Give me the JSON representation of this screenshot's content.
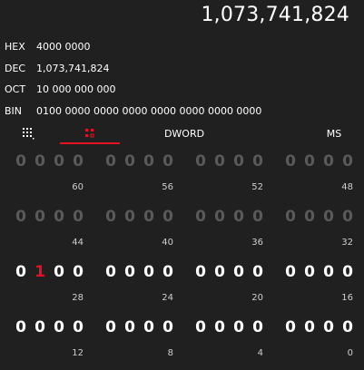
{
  "display": {
    "value": "1,073,741,824"
  },
  "radix": [
    {
      "label": "HEX",
      "value": "4000 0000"
    },
    {
      "label": "DEC",
      "value": "1,073,741,824"
    },
    {
      "label": "OCT",
      "value": "10 000 000 000"
    },
    {
      "label": "BIN",
      "value": "0100 0000 0000 0000 0000 0000 0000 0000"
    }
  ],
  "toolbar": {
    "keypad_icon": "full-keypad-icon",
    "bitflip_icon": "bit-toggling-keypad-icon",
    "word_size": "DWORD",
    "memory": "MS"
  },
  "colors": {
    "accent": "#e81123",
    "background": "#202020",
    "disabled": "#5a5a5a"
  },
  "bit_rows": [
    {
      "nibbles": [
        {
          "bits": [
            "0",
            "0",
            "0",
            "0"
          ],
          "position": "60",
          "enabled": false
        },
        {
          "bits": [
            "0",
            "0",
            "0",
            "0"
          ],
          "position": "56",
          "enabled": false
        },
        {
          "bits": [
            "0",
            "0",
            "0",
            "0"
          ],
          "position": "52",
          "enabled": false
        },
        {
          "bits": [
            "0",
            "0",
            "0",
            "0"
          ],
          "position": "48",
          "enabled": false
        }
      ]
    },
    {
      "nibbles": [
        {
          "bits": [
            "0",
            "0",
            "0",
            "0"
          ],
          "position": "44",
          "enabled": false
        },
        {
          "bits": [
            "0",
            "0",
            "0",
            "0"
          ],
          "position": "40",
          "enabled": false
        },
        {
          "bits": [
            "0",
            "0",
            "0",
            "0"
          ],
          "position": "36",
          "enabled": false
        },
        {
          "bits": [
            "0",
            "0",
            "0",
            "0"
          ],
          "position": "32",
          "enabled": false
        }
      ]
    },
    {
      "nibbles": [
        {
          "bits": [
            "0",
            "1",
            "0",
            "0"
          ],
          "position": "28",
          "enabled": true,
          "highlight": 1
        },
        {
          "bits": [
            "0",
            "0",
            "0",
            "0"
          ],
          "position": "24",
          "enabled": true
        },
        {
          "bits": [
            "0",
            "0",
            "0",
            "0"
          ],
          "position": "20",
          "enabled": true
        },
        {
          "bits": [
            "0",
            "0",
            "0",
            "0"
          ],
          "position": "16",
          "enabled": true
        }
      ]
    },
    {
      "nibbles": [
        {
          "bits": [
            "0",
            "0",
            "0",
            "0"
          ],
          "position": "12",
          "enabled": true
        },
        {
          "bits": [
            "0",
            "0",
            "0",
            "0"
          ],
          "position": "8",
          "enabled": true
        },
        {
          "bits": [
            "0",
            "0",
            "0",
            "0"
          ],
          "position": "4",
          "enabled": true
        },
        {
          "bits": [
            "0",
            "0",
            "0",
            "0"
          ],
          "position": "0",
          "enabled": true
        }
      ]
    }
  ]
}
